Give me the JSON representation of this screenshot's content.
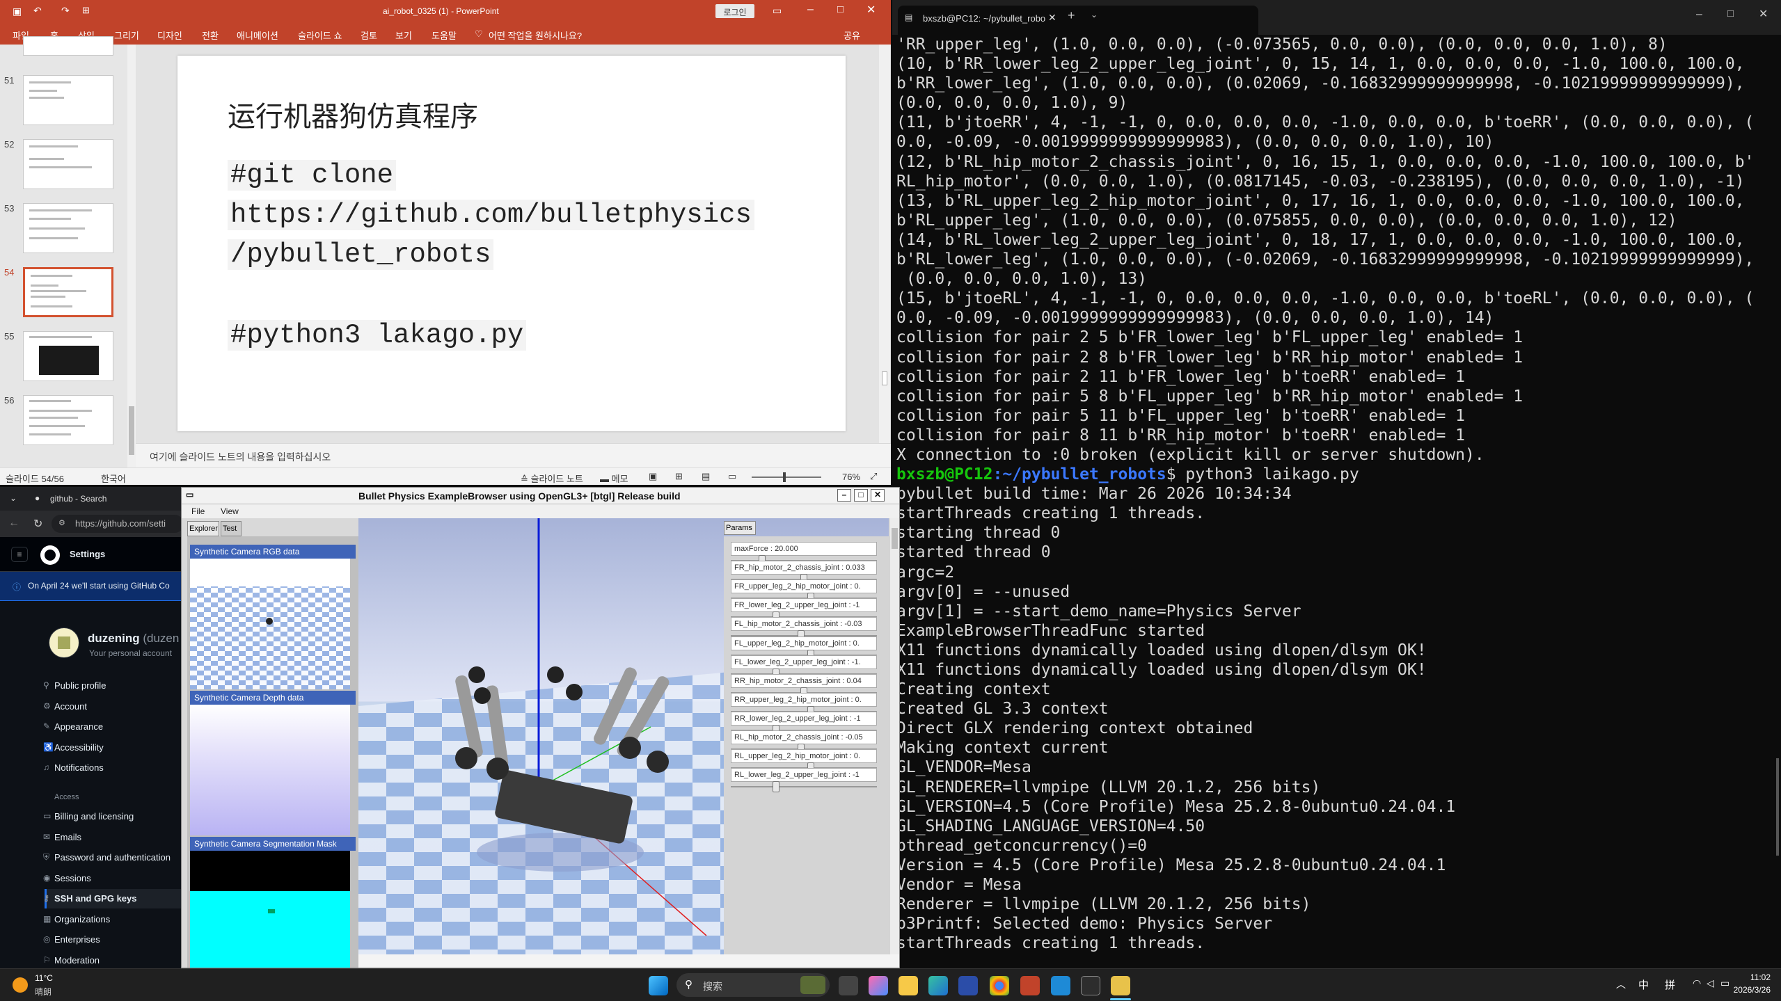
{
  "ppt": {
    "title": "ai_robot_0325 (1)  -  PowerPoint",
    "login": "로그인",
    "menu": [
      "파일",
      "홈",
      "삽입",
      "그리기",
      "디자인",
      "전환",
      "애니메이션",
      "슬라이드 쇼",
      "검토",
      "보기",
      "도움말"
    ],
    "tellme": "어떤 작업을 원하시나요?",
    "share": "공유",
    "thumbs": [
      "51",
      "52",
      "53",
      "54",
      "55",
      "56"
    ],
    "slide": {
      "title": "运行机器狗仿真程序",
      "code1": "#git clone",
      "code2": "https://github.com/bulletphysics",
      "code3": "/pybullet_robots",
      "code4": "#python3 lakago.py"
    },
    "notes_placeholder": "여기에 슬라이드 노트의 내용을 입력하십시오",
    "status_slide": "슬라이드 54/56",
    "status_lang": "한국어",
    "status_notes": "슬라이드 노트",
    "status_comments": "메모",
    "zoom": "76%"
  },
  "terminal": {
    "tab_title": "bxszb@PC12: ~/pybullet_robo",
    "lines_before": [
      "'RR_upper_leg', (1.0, 0.0, 0.0), (-0.073565, 0.0, 0.0), (0.0, 0.0, 0.0, 1.0), 8)",
      "(10, b'RR_lower_leg_2_upper_leg_joint', 0, 15, 14, 1, 0.0, 0.0, 0.0, -1.0, 100.0, 100.0,",
      "b'RR_lower_leg', (1.0, 0.0, 0.0), (0.02069, -0.16832999999999998, -0.10219999999999999),",
      "(0.0, 0.0, 0.0, 1.0), 9)",
      "(11, b'jtoeRR', 4, -1, -1, 0, 0.0, 0.0, 0.0, -1.0, 0.0, 0.0, b'toeRR', (0.0, 0.0, 0.0), (",
      "0.0, -0.09, -0.0019999999999999983), (0.0, 0.0, 0.0, 1.0), 10)",
      "(12, b'RL_hip_motor_2_chassis_joint', 0, 16, 15, 1, 0.0, 0.0, 0.0, -1.0, 100.0, 100.0, b'",
      "RL_hip_motor', (0.0, 0.0, 1.0), (0.0817145, -0.03, -0.238195), (0.0, 0.0, 0.0, 1.0), -1)",
      "(13, b'RL_upper_leg_2_hip_motor_joint', 0, 17, 16, 1, 0.0, 0.0, 0.0, -1.0, 100.0, 100.0,",
      "b'RL_upper_leg', (1.0, 0.0, 0.0), (0.075855, 0.0, 0.0), (0.0, 0.0, 0.0, 1.0), 12)",
      "(14, b'RL_lower_leg_2_upper_leg_joint', 0, 18, 17, 1, 0.0, 0.0, 0.0, -1.0, 100.0, 100.0,",
      "b'RL_lower_leg', (1.0, 0.0, 0.0), (-0.02069, -0.16832999999999998, -0.10219999999999999),",
      " (0.0, 0.0, 0.0, 1.0), 13)",
      "(15, b'jtoeRL', 4, -1, -1, 0, 0.0, 0.0, 0.0, -1.0, 0.0, 0.0, b'toeRL', (0.0, 0.0, 0.0), (",
      "0.0, -0.09, -0.0019999999999999983), (0.0, 0.0, 0.0, 1.0), 14)",
      "collision for pair 2 5 b'FR_lower_leg' b'FL_upper_leg' enabled= 1",
      "collision for pair 2 8 b'FR_lower_leg' b'RR_hip_motor' enabled= 1",
      "collision for pair 2 11 b'FR_lower_leg' b'toeRR' enabled= 1",
      "collision for pair 5 8 b'FL_upper_leg' b'RR_hip_motor' enabled= 1",
      "collision for pair 5 11 b'FL_upper_leg' b'toeRR' enabled= 1",
      "collision for pair 8 11 b'RR_hip_motor' b'toeRR' enabled= 1",
      "X connection to :0 broken (explicit kill or server shutdown)."
    ],
    "prompt_user": "bxszb@PC12",
    "prompt_path": ":~/pybullet_robots",
    "prompt_cmd": "$ python3 laikago.py",
    "lines_after": [
      "pybullet build time: Mar 26 2026 10:34:34",
      "startThreads creating 1 threads.",
      "starting thread 0",
      "started thread 0",
      "argc=2",
      "argv[0] = --unused",
      "argv[1] = --start_demo_name=Physics Server",
      "ExampleBrowserThreadFunc started",
      "X11 functions dynamically loaded using dlopen/dlsym OK!",
      "X11 functions dynamically loaded using dlopen/dlsym OK!",
      "Creating context",
      "Created GL 3.3 context",
      "Direct GLX rendering context obtained",
      "Making context current",
      "GL_VENDOR=Mesa",
      "GL_RENDERER=llvmpipe (LLVM 20.1.2, 256 bits)",
      "GL_VERSION=4.5 (Core Profile) Mesa 25.2.8-0ubuntu0.24.04.1",
      "GL_SHADING_LANGUAGE_VERSION=4.50",
      "pthread_getconcurrency()=0",
      "Version = 4.5 (Core Profile) Mesa 25.2.8-0ubuntu0.24.04.1",
      "Vendor = Mesa",
      "Renderer = llvmpipe (LLVM 20.1.2, 256 bits)",
      "b3Printf: Selected demo: Physics Server",
      "startThreads creating 1 threads."
    ]
  },
  "browser": {
    "tab_title": "github - Search",
    "url": "https://github.com/setti",
    "header": "Settings",
    "banner": "On April 24 we'll start using GitHub Co",
    "user_name": "duzening",
    "user_handle": "(duzen",
    "user_sub": "Your personal account",
    "nav": [
      "Public profile",
      "Account",
      "Appearance",
      "Accessibility",
      "Notifications"
    ],
    "access_heading": "Access",
    "access": [
      "Billing and licensing",
      "Emails",
      "Password and authentication",
      "Sessions",
      "SSH and GPG keys",
      "Organizations",
      "Enterprises",
      "Moderation"
    ]
  },
  "bullet": {
    "title": "Bullet Physics ExampleBrowser using OpenGL3+ [btgl] Release build",
    "menu": [
      "File",
      "View"
    ],
    "tabs": [
      "Explorer",
      "Test"
    ],
    "params_tab": "Params",
    "cams": [
      "Synthetic Camera RGB data",
      "Synthetic Camera Depth data",
      "Synthetic Camera Segmentation Mask"
    ],
    "params": [
      {
        "label": "maxForce : 20.000",
        "value": 0.2
      },
      {
        "label": "FR_hip_motor_2_chassis_joint : 0.033",
        "value": 0.5
      },
      {
        "label": "FR_upper_leg_2_hip_motor_joint : 0.",
        "value": 0.55
      },
      {
        "label": "FR_lower_leg_2_upper_leg_joint : -1",
        "value": 0.3
      },
      {
        "label": "FL_hip_motor_2_chassis_joint : -0.03",
        "value": 0.48
      },
      {
        "label": "FL_upper_leg_2_hip_motor_joint : 0.",
        "value": 0.55
      },
      {
        "label": "FL_lower_leg_2_upper_leg_joint : -1.",
        "value": 0.3
      },
      {
        "label": "RR_hip_motor_2_chassis_joint : 0.04",
        "value": 0.5
      },
      {
        "label": "RR_upper_leg_2_hip_motor_joint : 0.",
        "value": 0.55
      },
      {
        "label": "RR_lower_leg_2_upper_leg_joint : -1",
        "value": 0.3
      },
      {
        "label": "RL_hip_motor_2_chassis_joint : -0.05",
        "value": 0.48
      },
      {
        "label": "RL_upper_leg_2_hip_motor_joint : 0.",
        "value": 0.55
      },
      {
        "label": "RL_lower_leg_2_upper_leg_joint : -1",
        "value": 0.3
      }
    ]
  },
  "taskbar": {
    "weather_temp": "11°C",
    "weather_desc": "晴朗",
    "search": "搜索",
    "ime1": "中",
    "ime2": "拼",
    "time": "11:02",
    "date": "2026/3/26"
  }
}
